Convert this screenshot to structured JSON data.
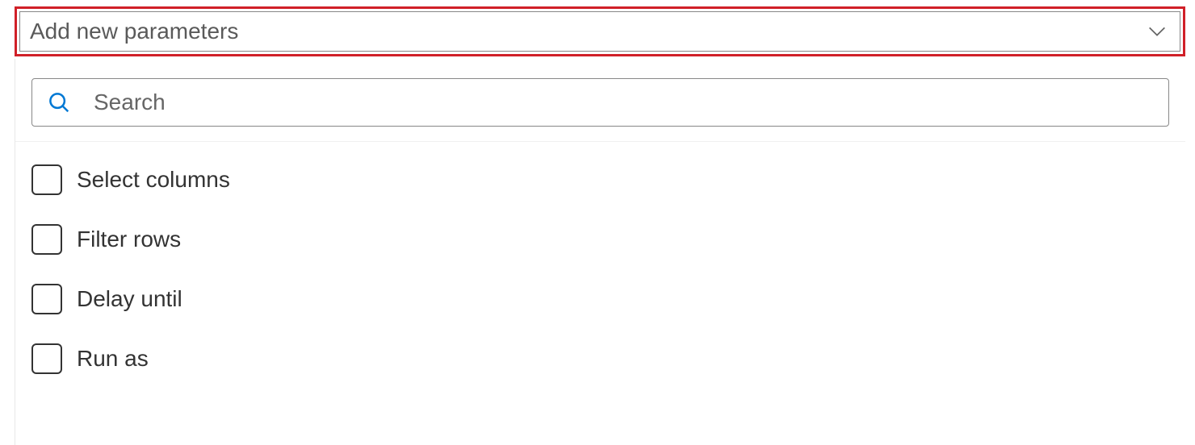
{
  "dropdown": {
    "label": "Add new parameters"
  },
  "search": {
    "placeholder": "Search"
  },
  "options": [
    {
      "label": "Select columns"
    },
    {
      "label": "Filter rows"
    },
    {
      "label": "Delay until"
    },
    {
      "label": "Run as"
    }
  ]
}
